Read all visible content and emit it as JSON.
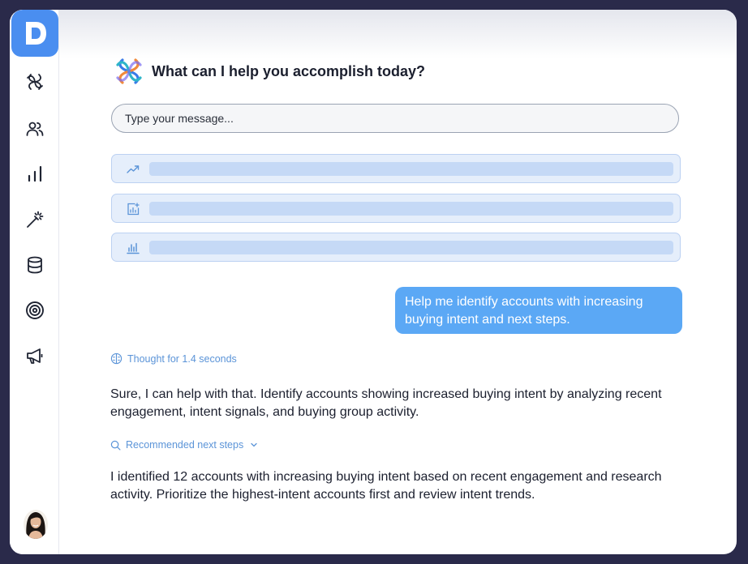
{
  "app": {
    "logo_letter": "D"
  },
  "sidebar": {
    "items": [
      {
        "icon": "knot-icon",
        "label": "Copilot"
      },
      {
        "icon": "users-icon",
        "label": "Accounts"
      },
      {
        "icon": "bar-chart-icon",
        "label": "Analytics"
      },
      {
        "icon": "magic-wand-icon",
        "label": "Automations"
      },
      {
        "icon": "database-icon",
        "label": "Data"
      },
      {
        "icon": "target-icon",
        "label": "Targeting"
      },
      {
        "icon": "megaphone-icon",
        "label": "Campaigns"
      }
    ]
  },
  "header": {
    "title": "What can I help you accomplish today?"
  },
  "composer": {
    "placeholder": "Type your message..."
  },
  "suggestions": [
    {
      "icon": "trend-up-icon"
    },
    {
      "icon": "chart-add-icon"
    },
    {
      "icon": "bar-chart-small-icon"
    }
  ],
  "conversation": {
    "user_message": "Help me identify accounts with increasing buying intent and next steps.",
    "thought_label": "Thought for 1.4 seconds",
    "assistant_reply": "Sure, I can help with that. Identify accounts showing increased buying intent by analyzing recent engagement, intent signals, and buying group activity.",
    "next_steps_label": "Recommended next steps",
    "assistant_followup": "I identified 12 accounts with increasing buying intent based on recent engagement and research activity. Prioritize the highest-intent accounts first and review intent trends."
  },
  "colors": {
    "accent": "#4a8ef0",
    "bubble": "#5ba8f5",
    "link": "#5b94d8",
    "frame": "#2a2a4a"
  }
}
